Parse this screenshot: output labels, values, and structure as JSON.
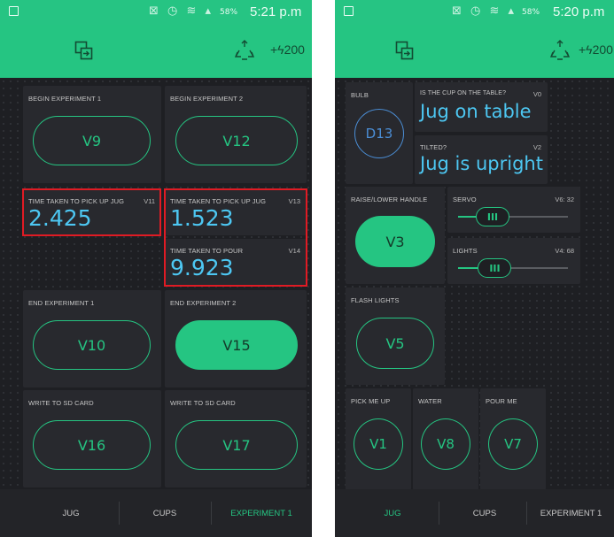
{
  "colors": {
    "accent": "#25c582",
    "value_text": "#4dc7f2",
    "highlight": "#e01b24",
    "background": "#1e1f23",
    "widget": "#28292e"
  },
  "left": {
    "status": {
      "icons": "⊠ ◷ ≋ ▴",
      "battery": "58%",
      "time": "5:21 p.m"
    },
    "toolbar": {
      "energy": "+ϟ200"
    },
    "widgets": {
      "begin1": {
        "label": "BEGIN EXPERIMENT 1",
        "button": "V9"
      },
      "begin2": {
        "label": "BEGIN EXPERIMENT 2",
        "button": "V12"
      },
      "pickup1": {
        "label": "TIME TAKEN TO PICK UP JUG",
        "pin": "V11",
        "value": "2.425"
      },
      "pickup2": {
        "label": "TIME TAKEN TO PICK UP JUG",
        "pin": "V13",
        "value": "1.523"
      },
      "pour": {
        "label": "TIME TAKEN TO POUR",
        "pin": "V14",
        "value": "9.923"
      },
      "end1": {
        "label": "END EXPERIMENT 1",
        "button": "V10"
      },
      "end2": {
        "label": "END EXPERIMENT 2",
        "button": "V15"
      },
      "sd1": {
        "label": "WRITE TO SD CARD",
        "button": "V16"
      },
      "sd2": {
        "label": "WRITE TO SD CARD",
        "button": "V17"
      }
    },
    "tabs": [
      "JUG",
      "CUPS",
      "EXPERIMENT 1"
    ],
    "active_tab": "EXPERIMENT 1"
  },
  "right": {
    "status": {
      "icons": "⊠ ◷ ≋ ▴",
      "battery": "58%",
      "time": "5:20 p.m"
    },
    "toolbar": {
      "energy": "+ϟ200"
    },
    "widgets": {
      "bulb": {
        "label": "BULB",
        "button": "D13"
      },
      "cup": {
        "label": "IS THE CUP ON THE TABLE?",
        "pin": "V0",
        "value": "Jug on table"
      },
      "tilted": {
        "label": "TILTED?",
        "pin": "V2",
        "value": "Jug is upright"
      },
      "raise": {
        "label": "RAISE/LOWER HANDLE",
        "button": "V3"
      },
      "servo": {
        "label": "SERVO",
        "pin": "V6: 32",
        "level_fraction": 0.25
      },
      "lights": {
        "label": "LIGHTS",
        "pin": "V4: 68",
        "level_fraction": 0.27
      },
      "flash": {
        "label": "FLASH LIGHTS",
        "button": "V5"
      },
      "pickme": {
        "label": "PICK ME UP",
        "button": "V1"
      },
      "water": {
        "label": "WATER",
        "button": "V8"
      },
      "pourme": {
        "label": "POUR ME",
        "button": "V7"
      },
      "knob_glyph": "III"
    },
    "tabs": [
      "JUG",
      "CUPS",
      "EXPERIMENT 1"
    ],
    "active_tab": "JUG"
  }
}
